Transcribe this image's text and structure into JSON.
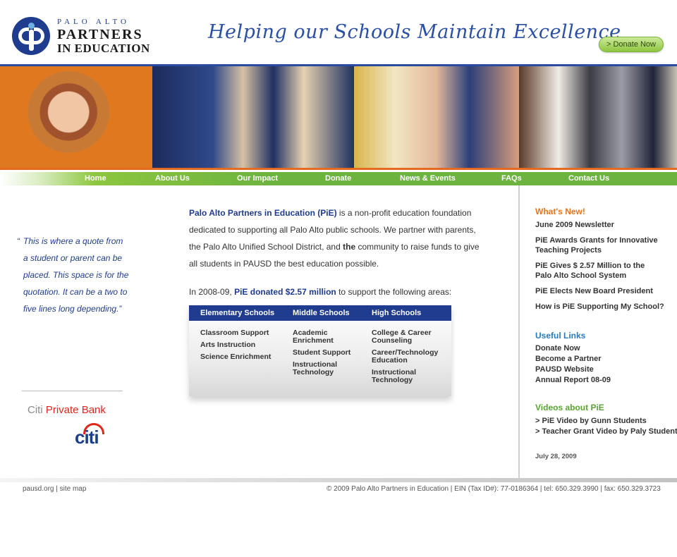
{
  "header": {
    "logo_line1": "PALO ALTO",
    "logo_line2": "PARTNERS",
    "logo_line3": "IN EDUCATION",
    "tagline": "Helping our Schools Maintain Excellence",
    "donate_button": "> Donate Now"
  },
  "nav": {
    "items": [
      "Home",
      "About Us",
      "Our Impact",
      "Donate",
      "News & Events",
      "FAQs",
      "Contact Us"
    ]
  },
  "quote": {
    "open_mark": "“",
    "text": "This is where a quote from a student or parent can be placed. This space is for the quotation. It can be a two to five lines long depending.”"
  },
  "sponsor": {
    "brand_gray": "Citi",
    "brand_red": "Private Bank",
    "logo_word": "citi"
  },
  "intro": {
    "org_name": "Palo Alto Partners in Education (PiE)",
    "text1": " is a non-profit education foundation dedicated to supporting all Palo Alto public schools. We partner with parents, the Palo Alto Unified School District, and ",
    "bold_word": "the",
    "text2": " community to raise funds to give all students in PAUSD the best education possible."
  },
  "donated": {
    "prefix": "In 2008-09, ",
    "amount": "PiE donated $2.57 million",
    "suffix": " to support the following areas:"
  },
  "areas": {
    "columns": [
      {
        "title": "Elementary Schools",
        "items": [
          "Classroom Support",
          "Arts Instruction",
          "Science Enrichment"
        ]
      },
      {
        "title": "Middle Schools",
        "items": [
          "Academic Enrichment",
          "Student Support",
          "Instructional Technology"
        ]
      },
      {
        "title": "High Schools",
        "items": [
          "College & Career Counseling",
          "Career/Technology Education",
          "Instructional Technology"
        ]
      }
    ]
  },
  "sidebar": {
    "whats_new_title": "What's New!",
    "whats_new": [
      "June 2009 Newsletter",
      "PiE Awards Grants for Innovative Teaching Projects",
      "PiE Gives $ 2.57 Million to the Palo Alto School System",
      "PiE Elects New Board President",
      "How is PiE Supporting My School?"
    ],
    "useful_links_title": "Useful Links",
    "useful_links": [
      "Donate Now",
      "Become a Partner",
      "PAUSD Website",
      "Annual Report 08-09"
    ],
    "videos_title": "Videos about PiE",
    "videos": [
      "> PiE Video by Gunn Students",
      "> Teacher Grant Video by Paly Students"
    ],
    "date": "July 28, 2009"
  },
  "footer": {
    "site_link": "pausd.org",
    "separator": " | ",
    "sitemap_link": "site map",
    "copyright": "© 2009 Palo Alto Partners in Education | EIN (Tax ID#): 77-0186364 | tel: 650.329.3990 | fax: 650.329.3723"
  },
  "colors": {
    "brand_blue": "#1f3c8f",
    "nav_green": "#6cb33f",
    "accent_orange": "#e5741f",
    "link_blue": "#2a7ab8",
    "video_green": "#5aa531"
  }
}
